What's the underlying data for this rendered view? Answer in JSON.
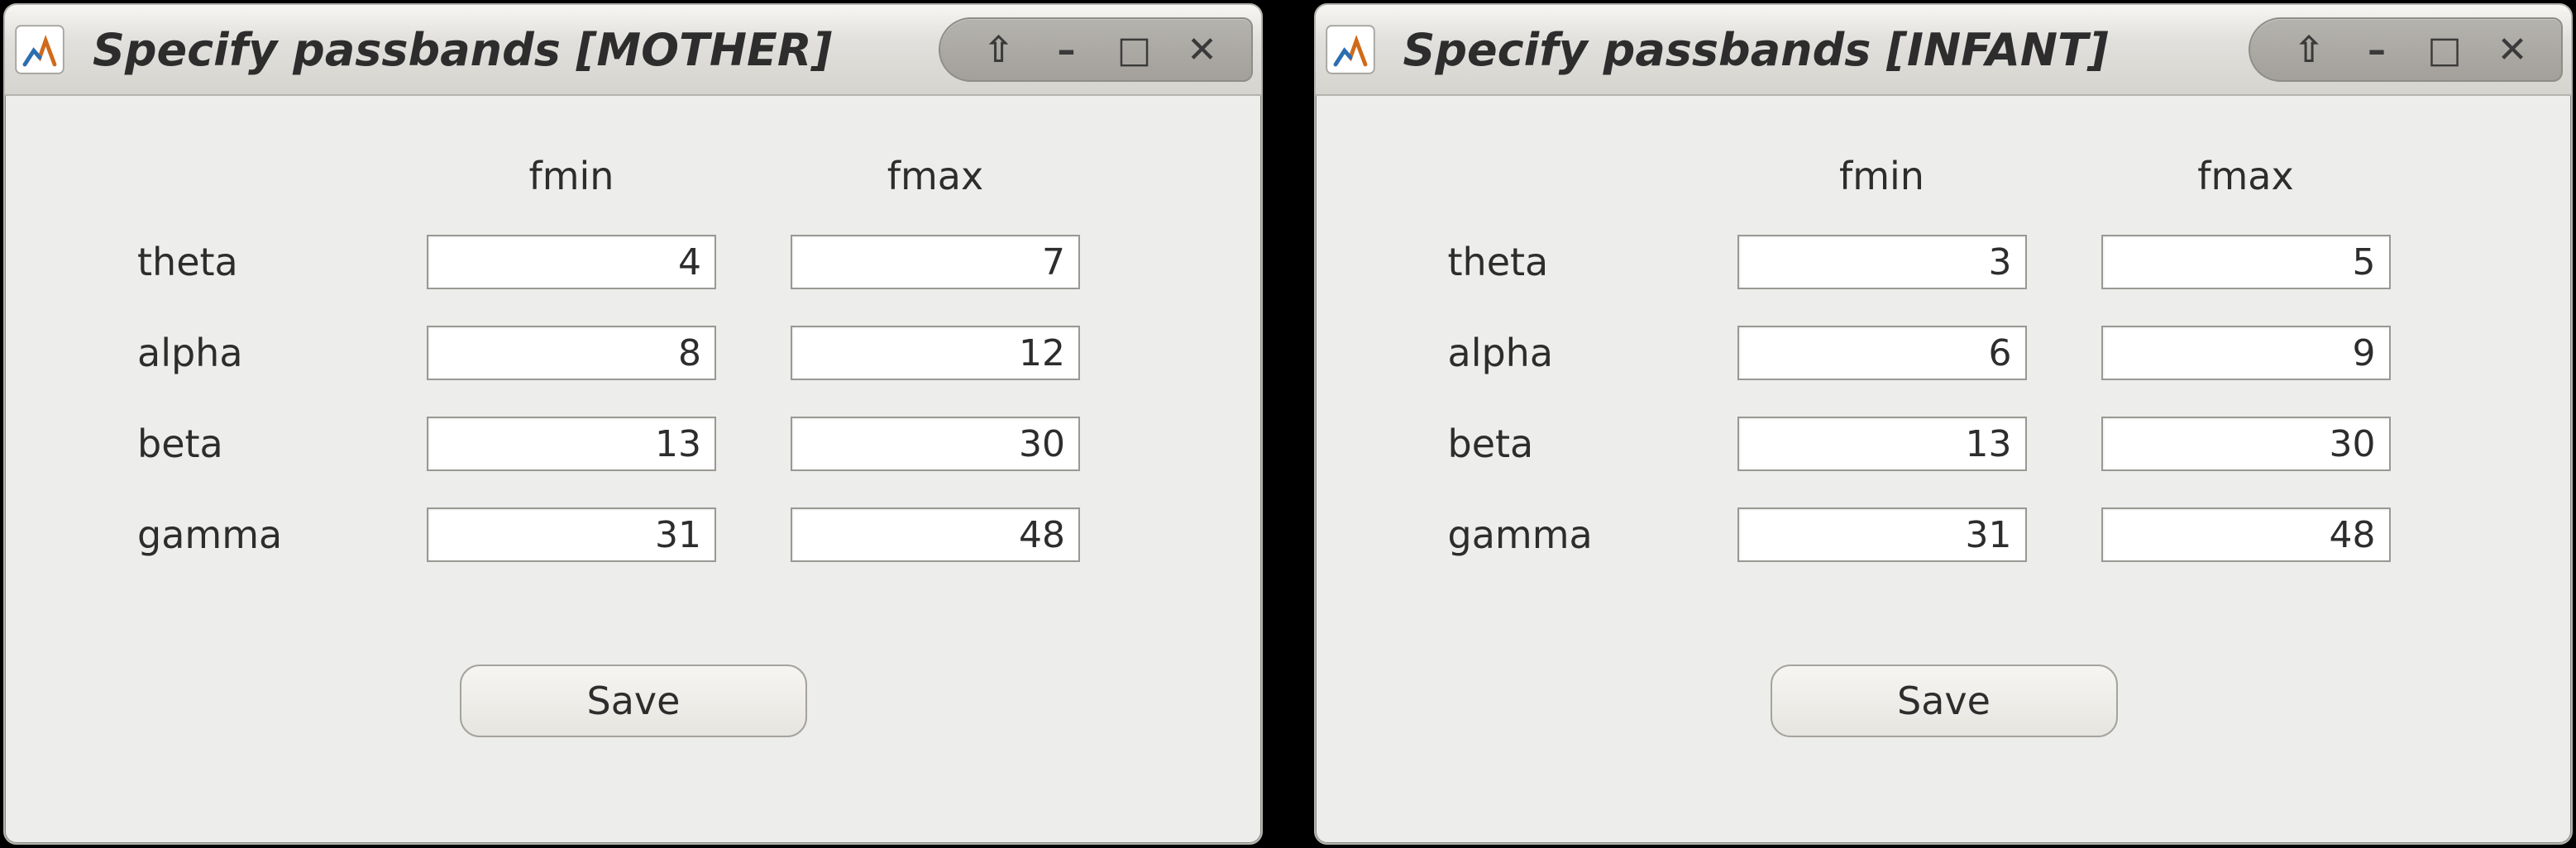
{
  "windows": [
    {
      "id": "mother",
      "title": "Specify passbands [MOTHER]",
      "headers": {
        "fmin": "fmin",
        "fmax": "fmax"
      },
      "rows": [
        {
          "label": "theta",
          "fmin": "4",
          "fmax": "7"
        },
        {
          "label": "alpha",
          "fmin": "8",
          "fmax": "12"
        },
        {
          "label": "beta",
          "fmin": "13",
          "fmax": "30"
        },
        {
          "label": "gamma",
          "fmin": "31",
          "fmax": "48"
        }
      ],
      "save_label": "Save"
    },
    {
      "id": "infant",
      "title": "Specify passbands [INFANT]",
      "headers": {
        "fmin": "fmin",
        "fmax": "fmax"
      },
      "rows": [
        {
          "label": "theta",
          "fmin": "3",
          "fmax": "5"
        },
        {
          "label": "alpha",
          "fmin": "6",
          "fmax": "9"
        },
        {
          "label": "beta",
          "fmin": "13",
          "fmax": "30"
        },
        {
          "label": "gamma",
          "fmin": "31",
          "fmax": "48"
        }
      ],
      "save_label": "Save"
    }
  ],
  "window_controls": {
    "always_on_top_icon": "⇧",
    "minimize_icon": "–",
    "maximize_icon": "□",
    "close_icon": "✕"
  }
}
